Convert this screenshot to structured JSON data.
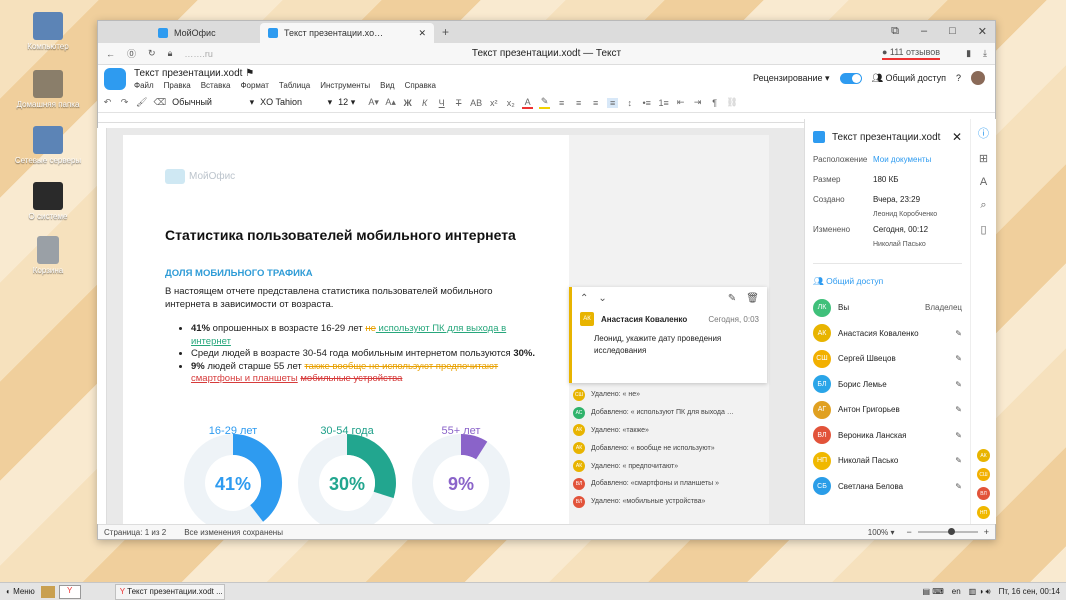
{
  "desktop": {
    "icons": [
      "Компьютер",
      "Домашняя папка",
      "Сетевые серверы",
      "О системе",
      "Корзина"
    ]
  },
  "browser": {
    "tabs": [
      "МойОфис",
      "Текст презентации.xo…"
    ],
    "url": "…….ru",
    "title": "Текст презентации.xodt — Текст",
    "reviews": "111 отзывов"
  },
  "app": {
    "filename": "Текст презентации.xodt",
    "menu": [
      "Файл",
      "Правка",
      "Вставка",
      "Формат",
      "Таблица",
      "Инструменты",
      "Вид",
      "Справка"
    ],
    "review_mode": "Рецензирование",
    "share_label": "Общий доступ",
    "style_select": "Обычный",
    "font_select": "XO Tahion",
    "font_size": "12"
  },
  "doc": {
    "brand": "МойОфис",
    "heading": "Статистика пользователей мобильного интернета",
    "subheading": "ДОЛЯ МОБИЛЬНОГО ТРАФИКА",
    "para1": "В настоящем отчете представлена статистика пользователей мобильного интернета в зависимости от возраста.",
    "b1_pct": "41%",
    "b1_a": " опрошенных в возрасте 16-29 лет ",
    "b1_del": "не",
    "b1_ins": " используют ПК для выхода в интернет",
    "b2_a": "Среди людей в возрасте 30-54 года мобильным интернетом пользуются ",
    "b2_pct": "30%.",
    "b3_pct": "9%",
    "b3_a": " людей старше 55 лет ",
    "b3_del1": "также вообще не используют предпочитают",
    "b3_ins": "смартфоны и планшеты",
    "b3_del2": "мобильные устройства",
    "chart": {
      "labels": [
        "16-29 лет",
        "30-54 года",
        "55+ лет"
      ],
      "values": [
        "41%",
        "30%",
        "9%"
      ]
    }
  },
  "comment": {
    "author": "Анастасия Коваленко",
    "initials": "АК",
    "time": "Сегодня, 0:03",
    "text": "Леонид, укажите дату проведения исследования"
  },
  "changes": [
    {
      "i": "СШ",
      "c": "#e8b400",
      "t": "Удалено: « не»"
    },
    {
      "i": "АС",
      "c": "#2fb36b",
      "t": "Добавлено: « используют ПК для выхода …"
    },
    {
      "i": "АК",
      "c": "#e8b400",
      "t": "Удалено: «также»"
    },
    {
      "i": "АК",
      "c": "#e8b400",
      "t": "Добавлено: « вообще не используют»"
    },
    {
      "i": "АК",
      "c": "#e8b400",
      "t": "Удалено: « предпочитают»"
    },
    {
      "i": "ВЛ",
      "c": "#e2533a",
      "t": "Добавлено: «смартфоны и планшеты »"
    },
    {
      "i": "ВЛ",
      "c": "#e2533a",
      "t": "Удалено: «мобильные устройства»"
    }
  ],
  "panel": {
    "title": "Текст презентации.xodt",
    "location_label": "Расположение",
    "location": "Мои документы",
    "size_label": "Размер",
    "size": "180 КБ",
    "created_label": "Создано",
    "created": "Вчера, 23:29",
    "created_by": "Леонид Коробченко",
    "modified_label": "Изменено",
    "modified": "Сегодня, 00:12",
    "modified_by": "Николай Пасько",
    "share_title": "Общий доступ",
    "people": [
      {
        "i": "ЛК",
        "c": "#3fc07a",
        "n": "Вы",
        "r": "Владелец"
      },
      {
        "i": "АК",
        "c": "#e8b400",
        "n": "Анастасия Коваленко"
      },
      {
        "i": "СШ",
        "c": "#f2b000",
        "n": "Сергей Швецов"
      },
      {
        "i": "БЛ",
        "c": "#2aa5e8",
        "n": "Борис Лемье"
      },
      {
        "i": "АГ",
        "c": "#e0a020",
        "n": "Антон Григорьев"
      },
      {
        "i": "ВЛ",
        "c": "#e2533a",
        "n": "Вероника Ланская"
      },
      {
        "i": "НП",
        "c": "#f0b800",
        "n": "Николай Пасько"
      },
      {
        "i": "СБ",
        "c": "#2a9de8",
        "n": "Светлана Белова"
      }
    ]
  },
  "status": {
    "page": "Страница: 1 из 2",
    "saved": "Все изменения сохранены",
    "zoom": "100%"
  },
  "taskbar": {
    "menu": "Меню",
    "window": "Текст презентации.xodt ...",
    "lang": "en",
    "clock": "Пт, 16 сен, 00:14"
  }
}
